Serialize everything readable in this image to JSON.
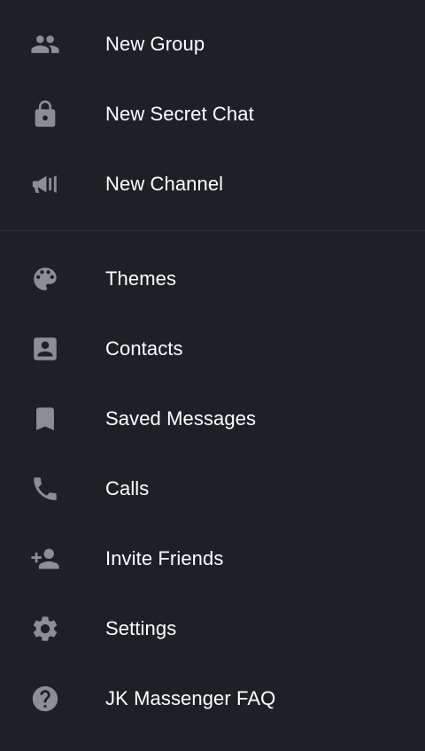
{
  "menu": {
    "top_items": [
      {
        "label": "New Group",
        "icon": "group-icon"
      },
      {
        "label": "New Secret Chat",
        "icon": "lock-icon"
      },
      {
        "label": "New Channel",
        "icon": "megaphone-icon"
      }
    ],
    "bottom_items": [
      {
        "label": "Themes",
        "icon": "palette-icon"
      },
      {
        "label": "Contacts",
        "icon": "contact-card-icon"
      },
      {
        "label": "Saved Messages",
        "icon": "bookmark-icon"
      },
      {
        "label": "Calls",
        "icon": "phone-icon"
      },
      {
        "label": "Invite Friends",
        "icon": "add-person-icon"
      },
      {
        "label": "Settings",
        "icon": "gear-icon"
      },
      {
        "label": "JK Massenger FAQ",
        "icon": "help-icon"
      }
    ]
  },
  "colors": {
    "background": "#1d2126",
    "icon": "#8a8f95",
    "text": "#ffffff",
    "divider": "#2b3036"
  }
}
